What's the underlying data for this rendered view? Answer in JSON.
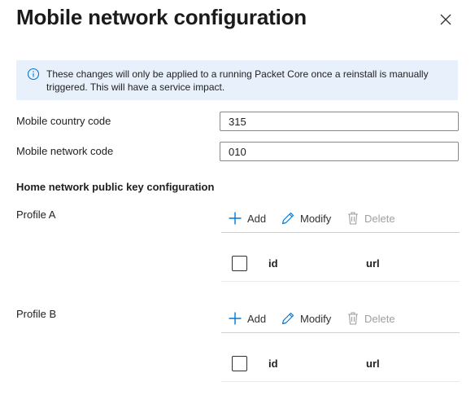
{
  "dialog": {
    "title": "Mobile network configuration",
    "close_icon": "close-icon"
  },
  "info_banner": {
    "icon": "info-icon",
    "text": "These changes will only be applied to a running Packet Core once a reinstall is manually triggered. This will have a service impact."
  },
  "fields": {
    "mcc": {
      "label": "Mobile country code",
      "value": "315"
    },
    "mnc": {
      "label": "Mobile network code",
      "value": "010"
    }
  },
  "home_network": {
    "heading": "Home network public key configuration",
    "profiles": [
      {
        "label": "Profile A",
        "toolbar": {
          "add": "Add",
          "modify": "Modify",
          "delete": "Delete"
        },
        "columns": {
          "id": "id",
          "url": "url"
        }
      },
      {
        "label": "Profile B",
        "toolbar": {
          "add": "Add",
          "modify": "Modify",
          "delete": "Delete"
        },
        "columns": {
          "id": "id",
          "url": "url"
        }
      }
    ]
  },
  "colors": {
    "banner_bg": "#e8f1fb",
    "accent": "#0078d4",
    "disabled": "#a19f9d"
  }
}
